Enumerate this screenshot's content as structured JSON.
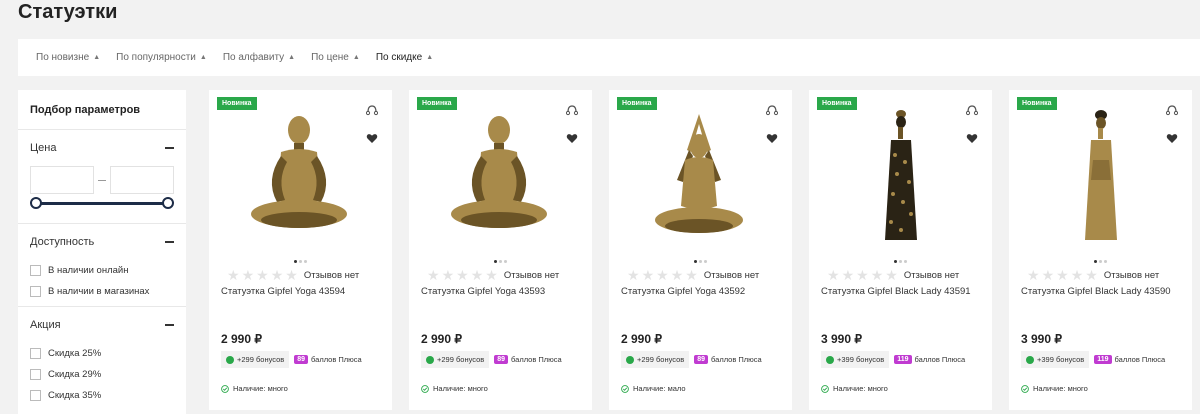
{
  "page": {
    "title": "Статуэтки"
  },
  "sort": [
    {
      "label": "По новизне",
      "active": false
    },
    {
      "label": "По популярности",
      "active": false
    },
    {
      "label": "По алфавиту",
      "active": false
    },
    {
      "label": "По цене",
      "active": false
    },
    {
      "label": "По скидке",
      "active": true
    }
  ],
  "filters": {
    "title": "Подбор параметров",
    "price": {
      "label": "Цена",
      "from_value": "",
      "to_value": ""
    },
    "availability": {
      "label": "Доступность",
      "options": [
        "В наличии онлайн",
        "В наличии в магазинах"
      ]
    },
    "sale": {
      "label": "Акция",
      "options": [
        "Скидка 25%",
        "Скидка 29%",
        "Скидка 35%"
      ]
    }
  },
  "products": [
    {
      "badge": "Новинка",
      "reviews": "Отзывов нет",
      "name": "Статуэтка Gipfel Yoga 43594",
      "price": "2 990 ₽",
      "bonus": "+299 бонусов",
      "plus_points": "89",
      "plus_label": "баллов Плюса",
      "stock": "Наличие: много",
      "figure": "yoga-lotus"
    },
    {
      "badge": "Новинка",
      "reviews": "Отзывов нет",
      "name": "Статуэтка Gipfel Yoga 43593",
      "price": "2 990 ₽",
      "bonus": "+299 бонусов",
      "plus_points": "89",
      "plus_label": "баллов Плюса",
      "stock": "Наличие: много",
      "figure": "yoga-lotus"
    },
    {
      "badge": "Новинка",
      "reviews": "Отзывов нет",
      "name": "Статуэтка Gipfel Yoga 43592",
      "price": "2 990 ₽",
      "bonus": "+299 бонусов",
      "plus_points": "89",
      "plus_label": "баллов Плюса",
      "stock": "Наличие: мало",
      "figure": "yoga-arms-up"
    },
    {
      "badge": "Новинка",
      "reviews": "Отзывов нет",
      "name": "Статуэтка Gipfel Black Lady 43591",
      "price": "3 990 ₽",
      "bonus": "+399 бонусов",
      "plus_points": "119",
      "plus_label": "баллов Плюса",
      "stock": "Наличие: много",
      "figure": "lady-leopard"
    },
    {
      "badge": "Новинка",
      "reviews": "Отзывов нет",
      "name": "Статуэтка Gipfel Black Lady 43590",
      "price": "3 990 ₽",
      "bonus": "+399 бонусов",
      "plus_points": "119",
      "plus_label": "баллов Плюса",
      "stock": "Наличие: много",
      "figure": "lady-gold"
    }
  ],
  "colors": {
    "badge": "#2aa84a",
    "plus": "#c03bd1",
    "slider": "#1d2c47",
    "figure_gold": "#a88a4a"
  }
}
